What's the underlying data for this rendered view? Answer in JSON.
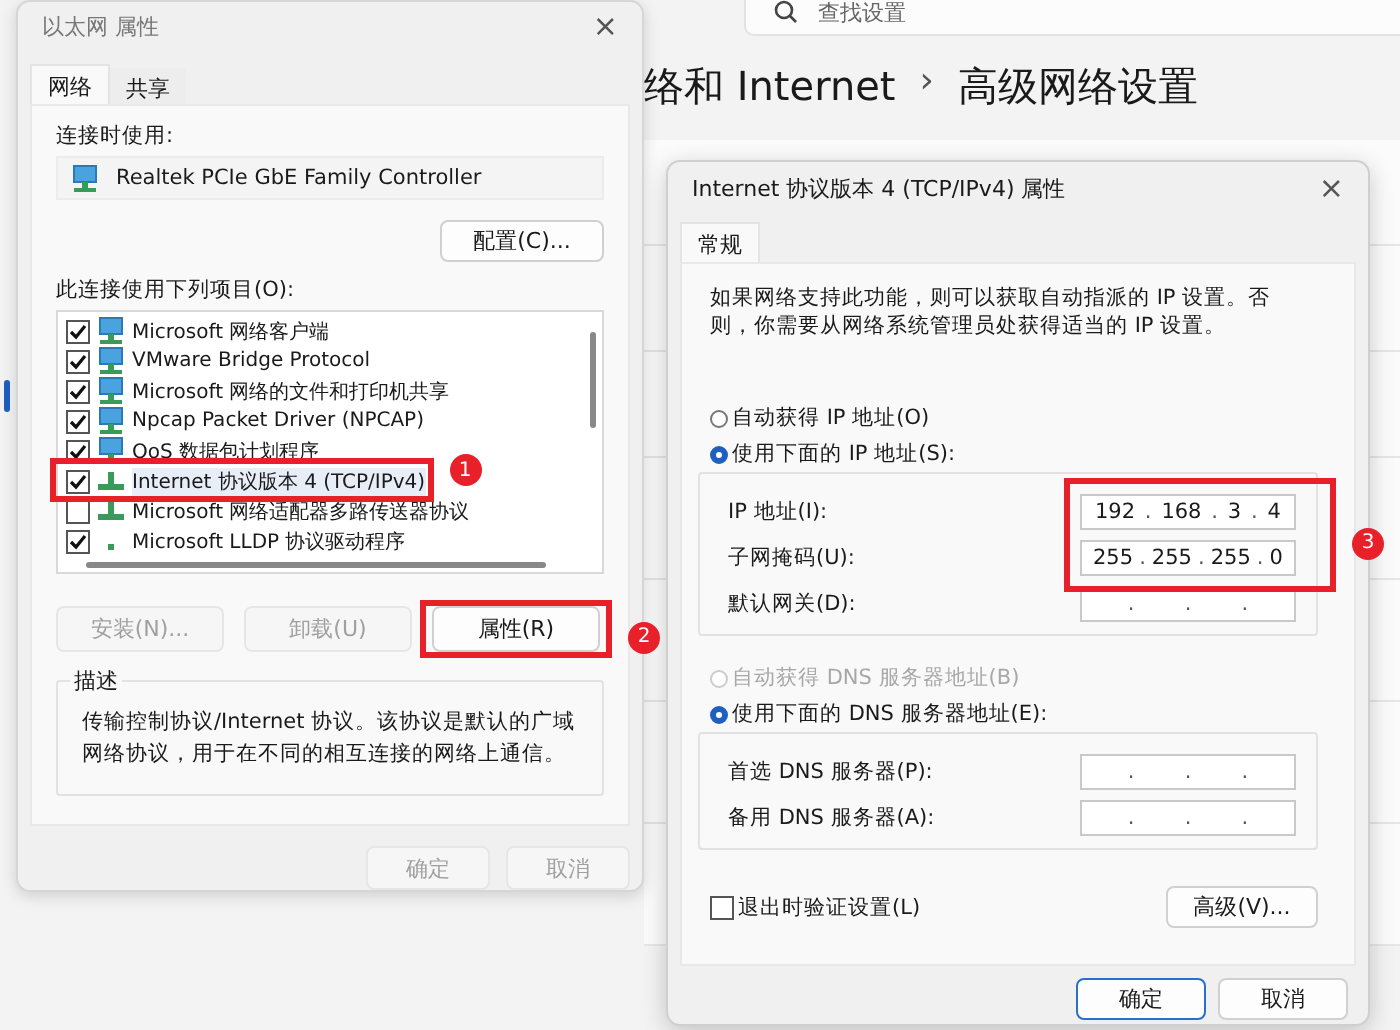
{
  "settings": {
    "search": {
      "placeholder": "查找设置"
    },
    "breadcrumb": [
      "络和 Internet",
      "›",
      "高级网络设置"
    ]
  },
  "ethernet_dialog": {
    "title": "以太网 属性",
    "close": "×",
    "tabs": [
      {
        "label": "网络",
        "selected": true
      },
      {
        "label": "共享",
        "selected": false
      }
    ],
    "connect_using_label": "连接时使用:",
    "adapter": "Realtek PCIe GbE Family Controller",
    "configure_button": "配置(C)...",
    "items_label": "此连接使用下列项目(O):",
    "items": [
      {
        "label": "Microsoft 网络客户端",
        "checked": true,
        "selected": false,
        "kind": "client"
      },
      {
        "label": "VMware Bridge Protocol",
        "checked": true,
        "selected": false,
        "kind": "client"
      },
      {
        "label": "Microsoft 网络的文件和打印机共享",
        "checked": true,
        "selected": false,
        "kind": "client"
      },
      {
        "label": "Npcap Packet Driver (NPCAP)",
        "checked": true,
        "selected": false,
        "kind": "client"
      },
      {
        "label": "QoS 数据包计划程序",
        "checked": true,
        "selected": false,
        "kind": "client"
      },
      {
        "label": "Internet 协议版本 4 (TCP/IPv4)",
        "checked": true,
        "selected": true,
        "kind": "protocol"
      },
      {
        "label": "Microsoft 网络适配器多路传送器协议",
        "checked": false,
        "selected": false,
        "kind": "protocol"
      },
      {
        "label": "Microsoft LLDP 协议驱动程序",
        "checked": true,
        "selected": false,
        "kind": "dot"
      }
    ],
    "buttons": [
      {
        "label": "安装(N)...",
        "disabled": true
      },
      {
        "label": "卸载(U)",
        "disabled": true
      },
      {
        "label": "属性(R)",
        "disabled": false
      }
    ],
    "description": {
      "title": "描述",
      "text": "传输控制协议/Internet 协议。该协议是默认的广域网络协议，用于在不同的相互连接的网络上通信。"
    },
    "footer_buttons": [
      {
        "label": "确定",
        "disabled": true
      },
      {
        "label": "取消",
        "disabled": true
      }
    ]
  },
  "ipv4_dialog": {
    "title": "Internet 协议版本 4 (TCP/IPv4) 属性",
    "close": "×",
    "tabs": [
      {
        "label": "常规",
        "selected": true
      }
    ],
    "intro": "如果网络支持此功能，则可以获取自动指派的 IP 设置。否则，你需要从网络系统管理员处获得适当的 IP 设置。",
    "ip_options": [
      {
        "label": "自动获得 IP 地址(O)",
        "selected": false,
        "disabled": false
      },
      {
        "label": "使用下面的 IP 地址(S):",
        "selected": true,
        "disabled": false
      }
    ],
    "separator": ".",
    "ip_fields": [
      {
        "label": "IP 地址(I):",
        "octets": [
          "192",
          "168",
          "3",
          "4"
        ]
      },
      {
        "label": "子网掩码(U):",
        "octets": [
          "255",
          "255",
          "255",
          "0"
        ]
      },
      {
        "label": "默认网关(D):"
      }
    ],
    "dns_options": [
      {
        "label": "自动获得 DNS 服务器地址(B)",
        "selected": false,
        "disabled": true
      },
      {
        "label": "使用下面的 DNS 服务器地址(E):",
        "selected": true,
        "disabled": false
      }
    ],
    "dns_fields": [
      {
        "label": "首选 DNS 服务器(P):"
      },
      {
        "label": "备用 DNS 服务器(A):"
      }
    ],
    "validate": {
      "label": "退出时验证设置(L)",
      "checked": false
    },
    "advanced_button": "高级(V)...",
    "footer_buttons": [
      {
        "label": "确定",
        "default": true
      },
      {
        "label": "取消",
        "default": false
      }
    ]
  },
  "annotations": [
    {
      "label": "1"
    },
    {
      "label": "2"
    },
    {
      "label": "3"
    }
  ]
}
